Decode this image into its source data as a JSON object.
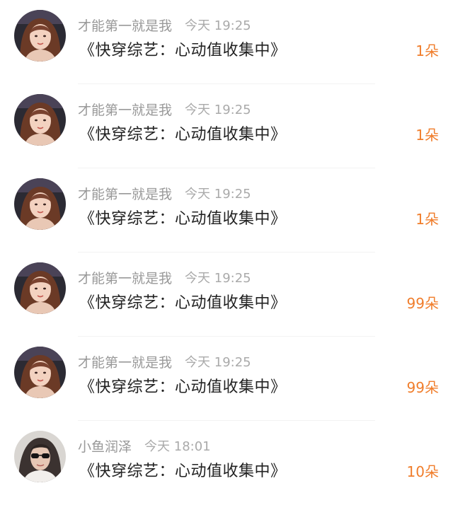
{
  "gifts": [
    {
      "user": "才能第一就是我",
      "time": "今天 19:25",
      "title": "《快穿综艺：心动值收集中》",
      "amount": "1朵",
      "avatar": "avatar-girl"
    },
    {
      "user": "才能第一就是我",
      "time": "今天 19:25",
      "title": "《快穿综艺：心动值收集中》",
      "amount": "1朵",
      "avatar": "avatar-girl"
    },
    {
      "user": "才能第一就是我",
      "time": "今天 19:25",
      "title": "《快穿综艺：心动值收集中》",
      "amount": "1朵",
      "avatar": "avatar-girl"
    },
    {
      "user": "才能第一就是我",
      "time": "今天 19:25",
      "title": "《快穿综艺：心动值收集中》",
      "amount": "99朵",
      "avatar": "avatar-girl"
    },
    {
      "user": "才能第一就是我",
      "time": "今天 19:25",
      "title": "《快穿综艺：心动值收集中》",
      "amount": "99朵",
      "avatar": "avatar-girl"
    },
    {
      "user": "小鱼润泽",
      "time": "今天 18:01",
      "title": "《快穿综艺：心动值收集中》",
      "amount": "10朵",
      "avatar": "avatar-sunglasses"
    }
  ],
  "colors": {
    "accent": "#f07d2b",
    "username": "#999999",
    "time": "#aaaaaa",
    "title": "#222222"
  }
}
